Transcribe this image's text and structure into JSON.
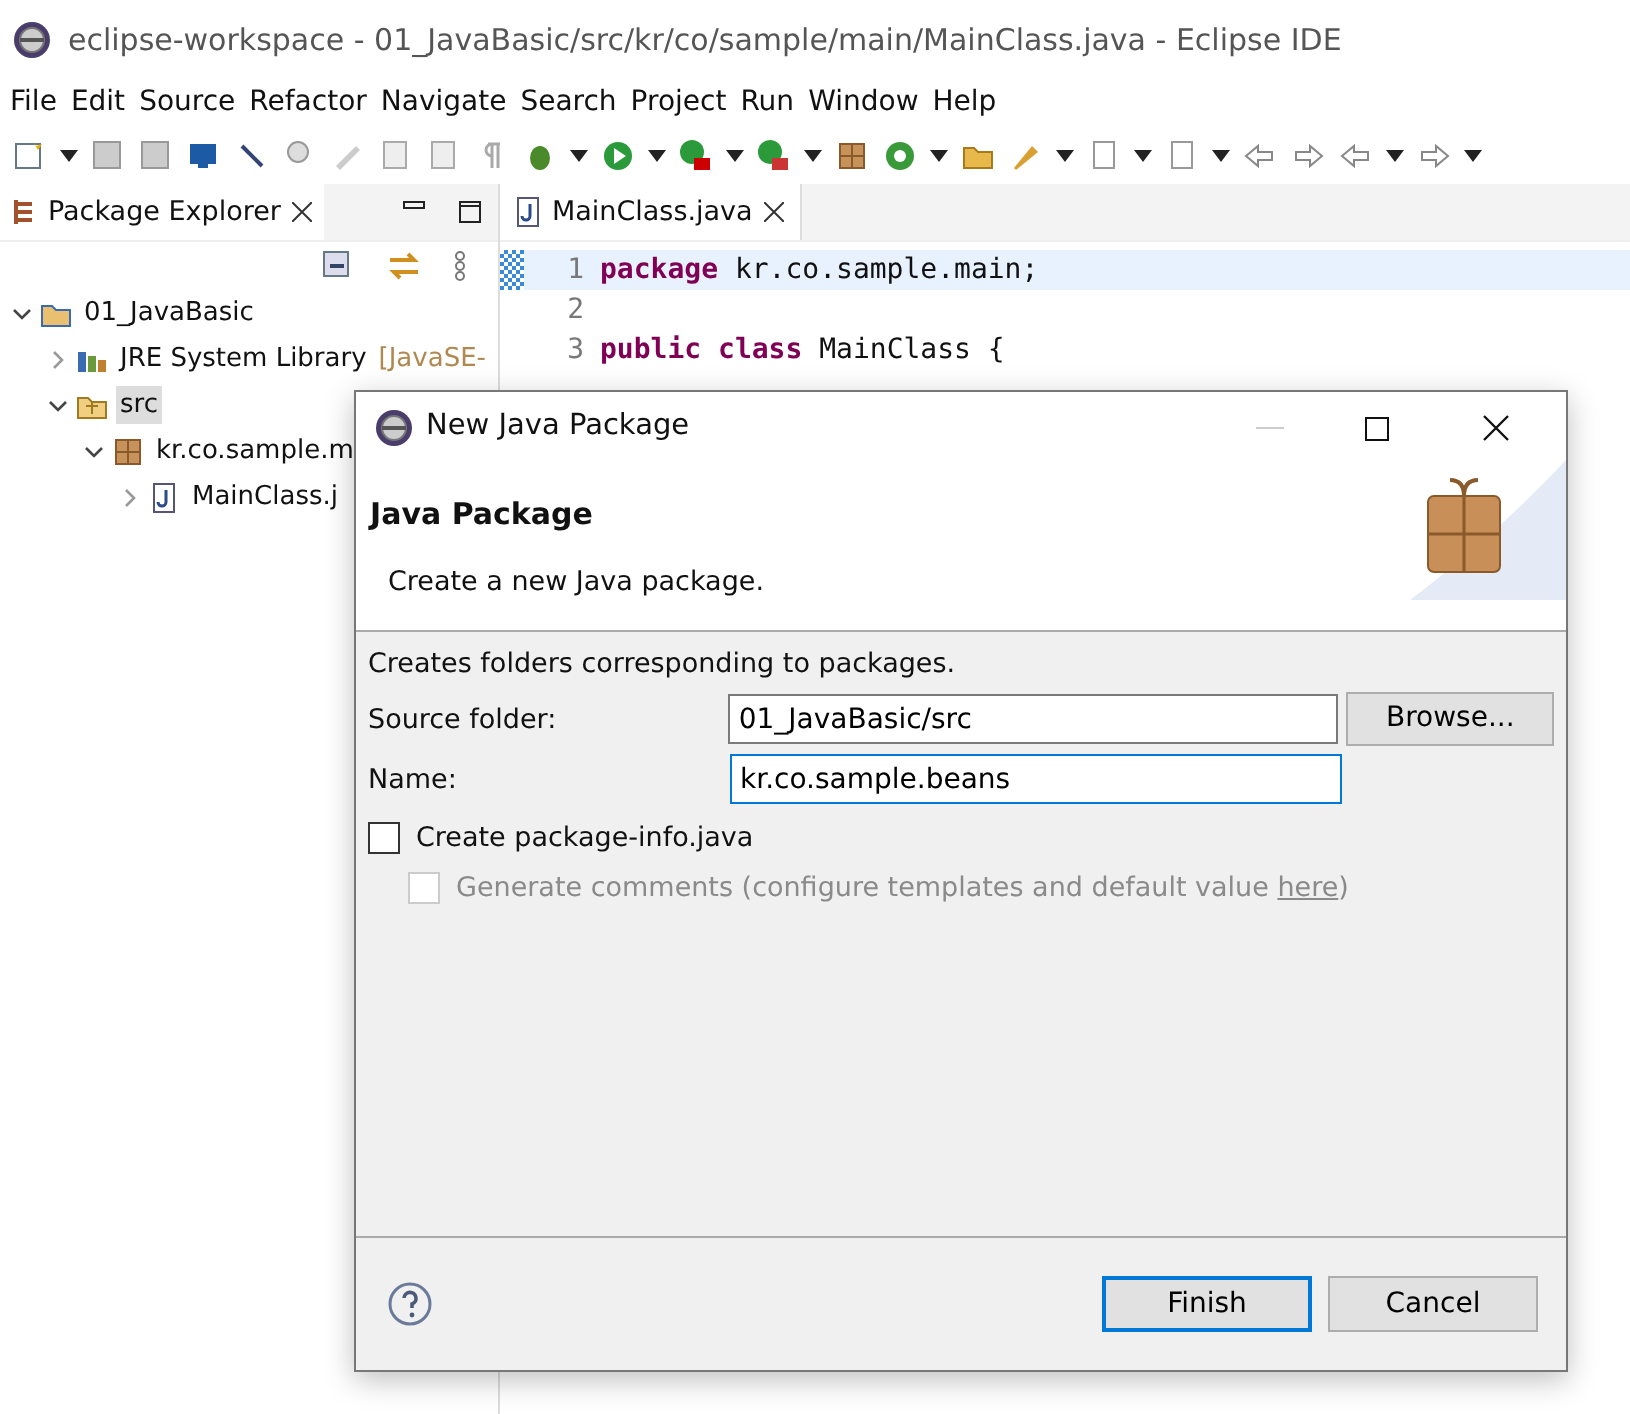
{
  "window": {
    "title": "eclipse-workspace - 01_JavaBasic/src/kr/co/sample/main/MainClass.java - Eclipse IDE"
  },
  "menu": [
    "File",
    "Edit",
    "Source",
    "Refactor",
    "Navigate",
    "Search",
    "Project",
    "Run",
    "Window",
    "Help"
  ],
  "explorer": {
    "title": "Package Explorer",
    "tree": [
      {
        "label": "01_JavaBasic",
        "kind": "project",
        "expanded": true,
        "selected": false,
        "children": [
          {
            "label": "JRE System Library",
            "suffix": "[JavaSE-",
            "kind": "library",
            "expanded": false,
            "selected": false
          },
          {
            "label": "src",
            "kind": "folder",
            "expanded": true,
            "selected": true,
            "children": [
              {
                "label": "kr.co.sample.m",
                "kind": "package",
                "expanded": true,
                "selected": false,
                "children": [
                  {
                    "label": "MainClass.j",
                    "kind": "file",
                    "expanded": false,
                    "selected": false
                  }
                ]
              }
            ]
          }
        ]
      }
    ]
  },
  "editor": {
    "tab": "MainClass.java",
    "lines": [
      {
        "number": "1",
        "current": true,
        "code": "**package** kr.co.sample.main;"
      },
      {
        "number": "2",
        "current": false
      },
      {
        "number": "3",
        "current": false,
        "code": "**public** **class** MainClass {"
      }
    ]
  },
  "dialog": {
    "title": "New Java Package",
    "heading": "Java Package",
    "description": "Create a new Java package.",
    "message": "Creates folders corresponding to packages.",
    "fields": [
      {
        "label": "Source folder:",
        "value": "01_JavaBasic/src",
        "focused": false,
        "button": "Browse..."
      },
      {
        "label": "Name:",
        "value": "kr.co.sample.beans",
        "focused": true
      }
    ],
    "options": [
      {
        "label": "Create package-info.java",
        "checked": false,
        "disabled": false
      },
      {
        "label": "Generate comments (configure templates and default value ",
        "link": "here",
        "tail": ")",
        "checked": false,
        "disabled": true
      }
    ],
    "buttons": [
      {
        "label": "Finish",
        "default": true
      },
      {
        "label": "Cancel",
        "default": false
      }
    ]
  }
}
